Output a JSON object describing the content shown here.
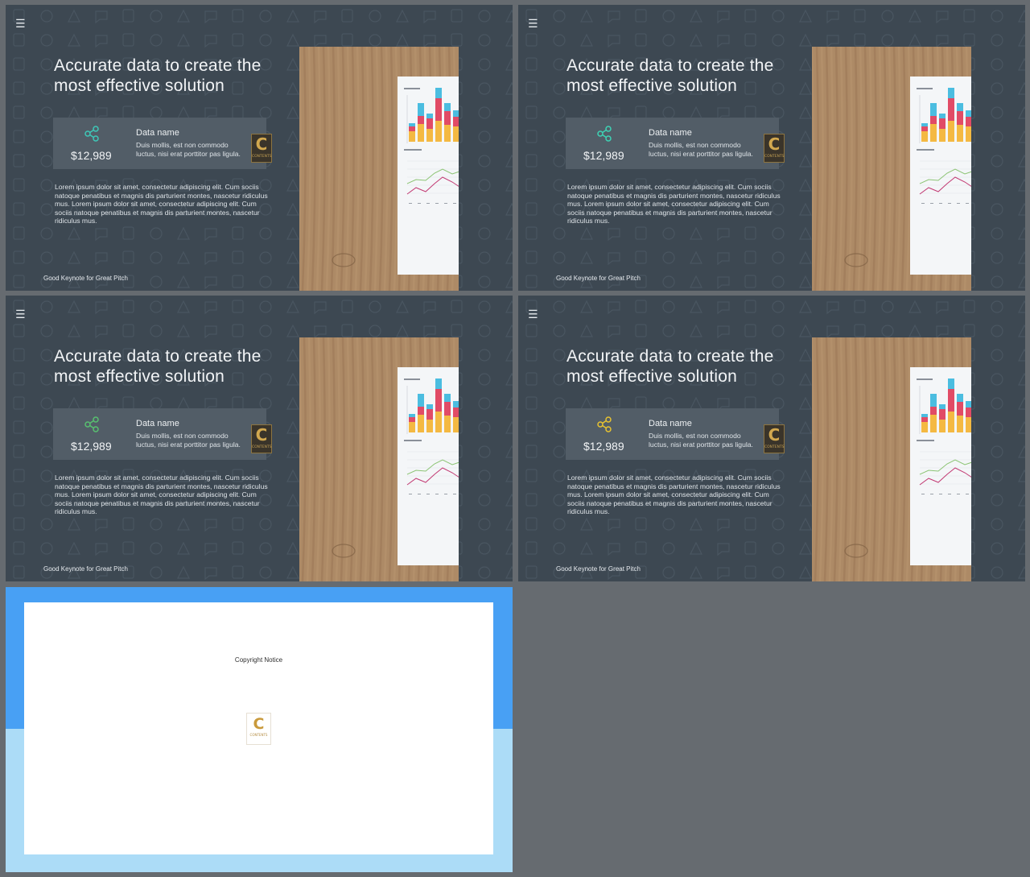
{
  "slides": [
    {
      "menu_icon": "menu-icon",
      "heading": "Accurate data to create the most effective solution",
      "card_icon": "share-icon",
      "card_icon_color": "#3ec8b8",
      "amount": "$12,989",
      "card_title": "Data name",
      "card_desc": "Duis mollis, est non commodo luctus, nisi erat porttitor pas ligula.",
      "badge_letter": "C",
      "badge_label": "CONTENTS",
      "body_text": "Lorem ipsum dolor sit amet, consectetur adipiscing elit. Cum sociis natoque penatibus et magnis dis parturient montes, nascetur ridiculus mus.  Lorem ipsum dolor sit amet, consectetur adipiscing elit. Cum sociis natoque penatibus et magnis dis parturient montes, nascetur ridiculus mus.",
      "footer": "Good Keynote for Great Pitch"
    },
    {
      "menu_icon": "menu-icon",
      "heading": "Accurate data to create the most effective solution",
      "card_icon": "share-icon",
      "card_icon_color": "#3ed3b5",
      "amount": "$12,989",
      "card_title": "Data name",
      "card_desc": "Duis mollis, est non commodo luctus, nisi erat porttitor pas ligula.",
      "badge_letter": "C",
      "badge_label": "CONTENTS",
      "body_text": "Lorem ipsum dolor sit amet, consectetur adipiscing elit. Cum sociis natoque penatibus et magnis dis parturient montes, nascetur ridiculus mus.  Lorem ipsum dolor sit amet, consectetur adipiscing elit. Cum sociis natoque penatibus et magnis dis parturient montes, nascetur ridiculus mus.",
      "footer": "Good Keynote for Great Pitch"
    },
    {
      "menu_icon": "menu-icon",
      "heading": "Accurate data to create the most effective solution",
      "card_icon": "share-icon",
      "card_icon_color": "#58c070",
      "amount": "$12,989",
      "card_title": "Data name",
      "card_desc": "Duis mollis, est non commodo luctus, nisi erat porttitor pas ligula.",
      "badge_letter": "C",
      "badge_label": "CONTENTS",
      "body_text": "Lorem ipsum dolor sit amet, consectetur adipiscing elit. Cum sociis natoque penatibus et magnis dis parturient montes, nascetur ridiculus mus.  Lorem ipsum dolor sit amet, consectetur adipiscing elit. Cum sociis natoque penatibus et magnis dis parturient montes, nascetur ridiculus mus.",
      "footer": "Good Keynote for Great Pitch"
    },
    {
      "menu_icon": "menu-icon",
      "heading": "Accurate data to create the most effective solution",
      "card_icon": "share-icon",
      "card_icon_color": "#e7c231",
      "amount": "$12,989",
      "card_title": "Data name",
      "card_desc": "Duis mollis, est non commodo luctus, nisi erat porttitor pas ligula.",
      "badge_letter": "C",
      "badge_label": "CONTENTS",
      "body_text": "Lorem ipsum dolor sit amet, consectetur adipiscing elit. Cum sociis natoque penatibus et magnis dis parturient montes, nascetur ridiculus mus.  Lorem ipsum dolor sit amet, consectetur adipiscing elit. Cum sociis natoque penatibus et magnis dis parturient montes, nascetur ridiculus mus.",
      "footer": "Good Keynote for Great Pitch"
    }
  ],
  "copyright_slide": {
    "title": "Copyright Notice",
    "logo_letter": "C",
    "logo_label": "CONTENTS",
    "colors": {
      "top_band": "#48a0f4",
      "bottom_band": "#acdcf7",
      "paper": "#ffffff"
    }
  },
  "colors": {
    "workspace_background": "#666b70",
    "slide_background": "#3d4852",
    "card_background": "#525d67",
    "chart_cyan": "#4bbde0",
    "chart_red": "#e14b66",
    "chart_orange": "#f4b942"
  }
}
